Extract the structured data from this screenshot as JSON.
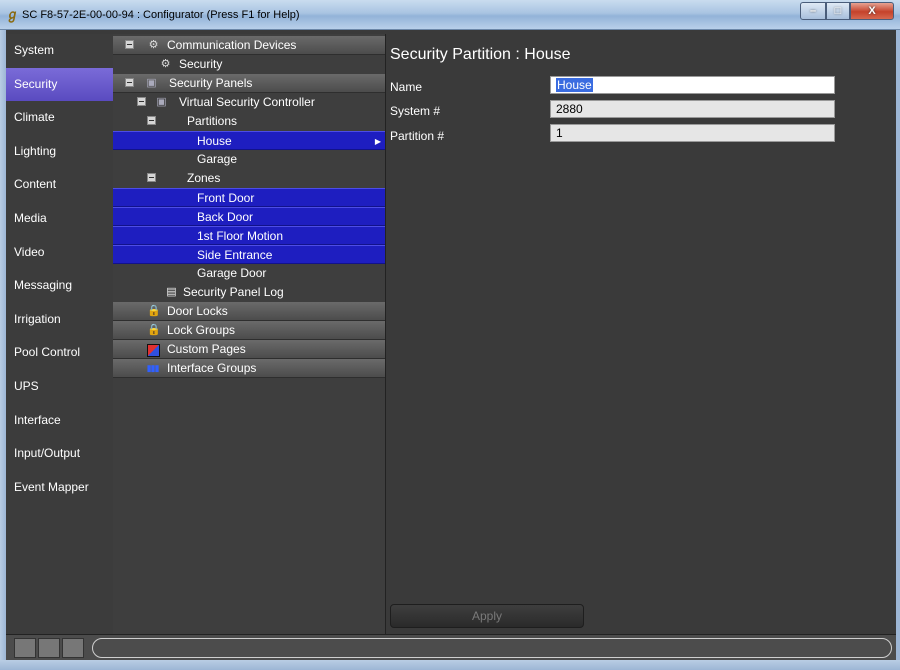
{
  "window": {
    "title": "SC F8-57-2E-00-00-94 : Configurator   (Press F1 for Help)",
    "app_icon": "configurator-logo-icon",
    "buttons": {
      "minimize": "–",
      "maximize": "□",
      "close": "X"
    }
  },
  "nav": {
    "items": [
      {
        "label": "System"
      },
      {
        "label": "Security",
        "active": true
      },
      {
        "label": "Climate"
      },
      {
        "label": "Lighting"
      },
      {
        "label": "Content"
      },
      {
        "label": "Media"
      },
      {
        "label": "Video"
      },
      {
        "label": "Messaging"
      },
      {
        "label": "Irrigation"
      },
      {
        "label": "Pool Control"
      },
      {
        "label": "UPS"
      },
      {
        "label": "Interface"
      },
      {
        "label": "Input/Output"
      },
      {
        "label": "Event Mapper"
      }
    ],
    "active_color": "#6a5acf"
  },
  "tree": {
    "items": [
      {
        "label": "Communication Devices",
        "type": "category",
        "icon": "communication-devices-icon"
      },
      {
        "label": "Security",
        "type": "leaf",
        "icon": "communication-devices-icon"
      },
      {
        "label": "Security Panels",
        "type": "category",
        "icon": "security-panel-icon"
      },
      {
        "label": "Virtual Security Controller",
        "type": "node",
        "icon": "security-panel-icon"
      },
      {
        "label": "Partitions",
        "type": "node"
      },
      {
        "label": "House",
        "type": "leaf",
        "selected": true
      },
      {
        "label": "Garage",
        "type": "leaf"
      },
      {
        "label": "Zones",
        "type": "node"
      },
      {
        "label": "Front Door",
        "type": "leaf",
        "selected": true
      },
      {
        "label": "Back Door",
        "type": "leaf",
        "selected": true
      },
      {
        "label": "1st Floor Motion",
        "type": "leaf",
        "selected": true
      },
      {
        "label": "Side Entrance",
        "type": "leaf",
        "selected": true
      },
      {
        "label": "Garage Door",
        "type": "leaf"
      },
      {
        "label": "Security Panel Log",
        "type": "leaf",
        "icon": "log-document-icon"
      },
      {
        "label": "Door Locks",
        "type": "category",
        "icon": "padlock-icon"
      },
      {
        "label": "Lock Groups",
        "type": "category",
        "icon": "padlock-icon"
      },
      {
        "label": "Custom Pages",
        "type": "category",
        "icon": "custom-pages-icon"
      },
      {
        "label": "Interface Groups",
        "type": "category",
        "icon": "interface-groups-icon"
      }
    ],
    "selection_color": "#1e1ec0"
  },
  "detail": {
    "heading": "Security Partition : House",
    "fields": [
      {
        "label": "Name",
        "value": "House"
      },
      {
        "label": "System #",
        "value": "2880"
      },
      {
        "label": "Partition #",
        "value": "1"
      }
    ],
    "apply_label": "Apply"
  }
}
